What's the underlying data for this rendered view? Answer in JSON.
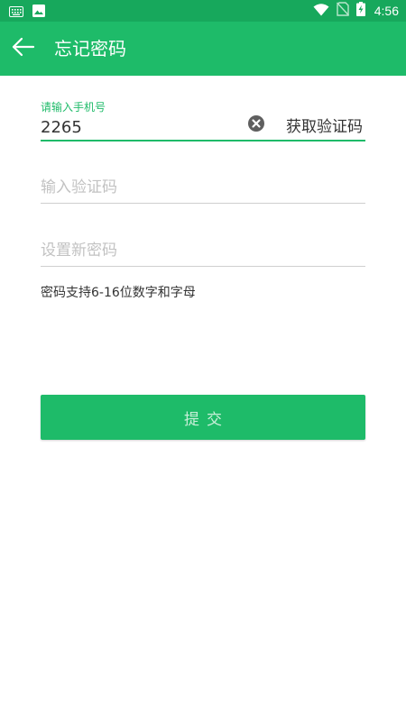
{
  "status_bar": {
    "time": "4:56",
    "left_icons": [
      "keyboard-icon",
      "image-icon"
    ],
    "right_icons": [
      "wifi-icon",
      "no-sim-icon",
      "battery-charging-icon"
    ],
    "background_color": "#17a85c"
  },
  "app_bar": {
    "title": "忘记密码",
    "back_icon": "arrow-left-icon",
    "background_color": "#1ebb69"
  },
  "form": {
    "phone": {
      "label": "请输入手机号",
      "value": "2265",
      "clear_icon": "clear-circle-icon",
      "get_code_label": "获取验证码"
    },
    "code": {
      "placeholder": "输入验证码",
      "value": ""
    },
    "password": {
      "placeholder": "设置新密码",
      "value": ""
    },
    "hint": "密码支持6-16位数字和字母",
    "submit_label": "提交"
  },
  "colors": {
    "accent": "#1ebb69",
    "submit_text": "#c9efd9",
    "divider": "#cfcfcf",
    "placeholder": "#c2c2c2",
    "text": "#333333"
  }
}
